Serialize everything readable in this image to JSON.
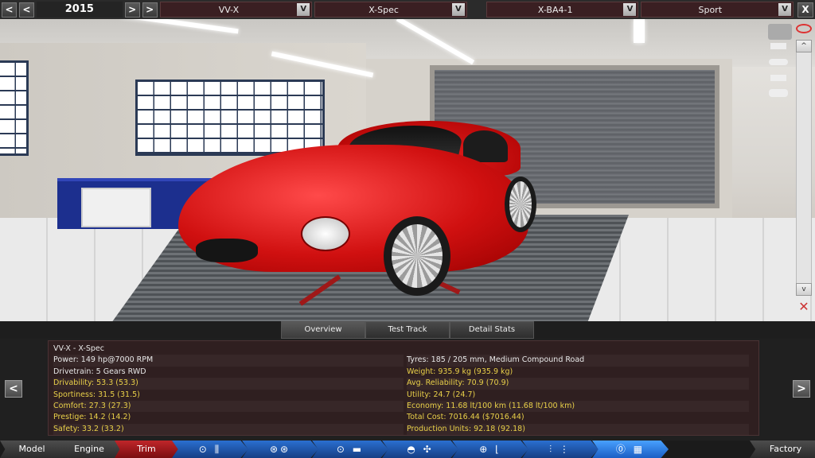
{
  "topbar": {
    "prev_label": "<",
    "prev2_label": "<",
    "year": "2015",
    "next_label": ">",
    "next2_label": ">",
    "model": "VV-X",
    "trim": "X-Spec",
    "engine": "X-BA4-1",
    "style": "Sport",
    "dropdown_glyph": "V",
    "close_label": "X"
  },
  "tabs": [
    "Overview",
    "Test Track",
    "Detail Stats"
  ],
  "panel": {
    "prev_label": "<",
    "next_label": ">",
    "left": [
      {
        "text": "VV-X - X-Spec",
        "hi": false
      },
      {
        "text": "Power: 149 hp@7000 RPM",
        "hi": false
      },
      {
        "text": "Drivetrain: 5 Gears RWD",
        "hi": false
      },
      {
        "text": "Drivability: 53.3 (53.3)",
        "hi": true
      },
      {
        "text": "Sportiness: 31.5 (31.5)",
        "hi": true
      },
      {
        "text": "Comfort: 27.3 (27.3)",
        "hi": true
      },
      {
        "text": "Prestige: 14.2 (14.2)",
        "hi": true
      },
      {
        "text": "Safety: 33.2 (33.2)",
        "hi": true
      }
    ],
    "right": [
      {
        "text": "",
        "hi": false
      },
      {
        "text": "Tyres: 185 / 205 mm, Medium Compound Road",
        "hi": false
      },
      {
        "text": "Weight: 935.9 kg (935.9 kg)",
        "hi": true
      },
      {
        "text": "Avg. Reliability: 70.9 (70.9)",
        "hi": true
      },
      {
        "text": "Utility: 24.7 (24.7)",
        "hi": true
      },
      {
        "text": "Economy: 11.68 lt/100 km (11.68 lt/100 km)",
        "hi": true
      },
      {
        "text": "Total Cost: 7016.44 ($7016.44)",
        "hi": true
      },
      {
        "text": "Production Units: 92.18 (92.18)",
        "hi": true
      }
    ]
  },
  "nav": {
    "model": "Model",
    "engine": "Engine",
    "trim": "Trim",
    "factory": "Factory",
    "icons": [
      "⊙ ⫼",
      "⊛⊛",
      "⊙ ▬",
      "◓ ✣",
      "⊕ ⌊",
      "⫶ ⋮",
      "⓪ ▦"
    ]
  },
  "tools": {
    "scroll_up": "^",
    "scroll_down": "v"
  }
}
